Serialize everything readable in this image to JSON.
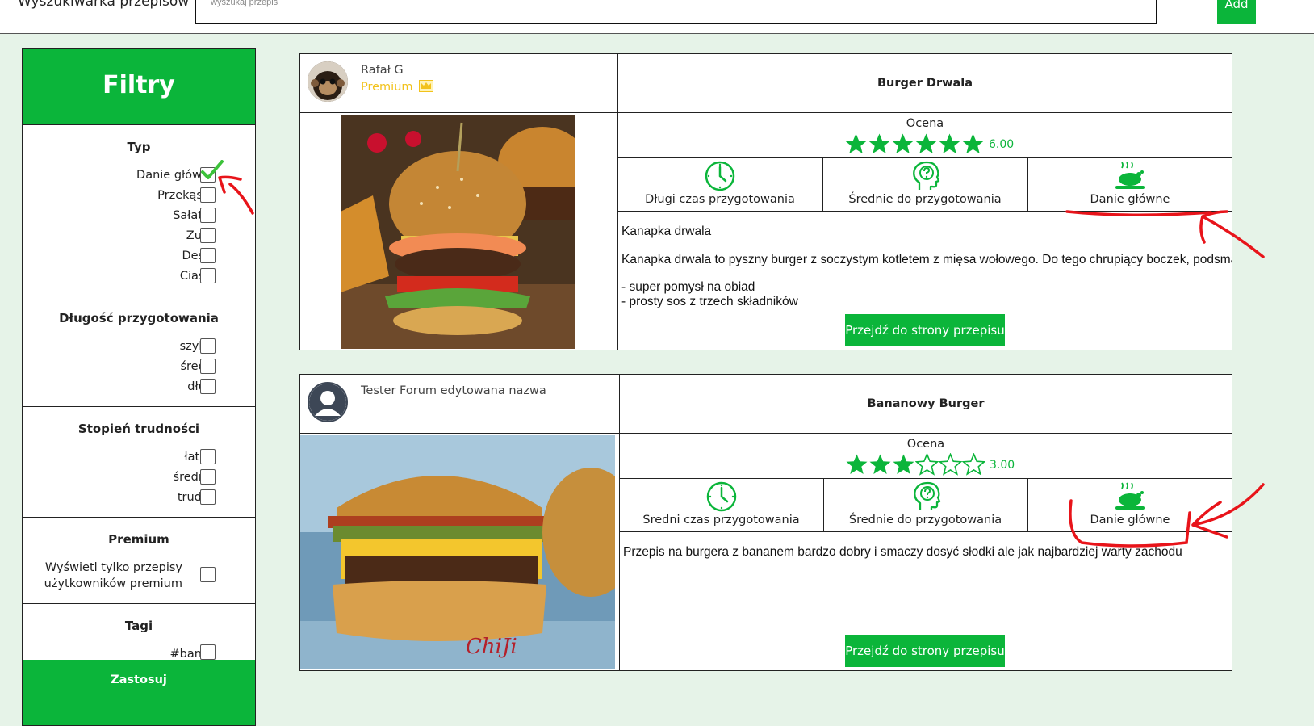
{
  "header": {
    "brand": "Wyszukiwarka przepisów",
    "search_placeholder": "wyszukaj przepis",
    "add_label": "Add"
  },
  "filters": {
    "title": "Filtry",
    "typ": {
      "title": "Typ",
      "options": [
        "Danie główne",
        "Przekąska",
        "Sałatka",
        "Zupa",
        "Deser",
        "Ciasto"
      ],
      "checked": [
        true,
        false,
        false,
        false,
        false,
        false
      ]
    },
    "dlugosc": {
      "title": "Długość przygotowania",
      "options": [
        "szybki",
        "średni",
        "długi"
      ]
    },
    "trudnosc": {
      "title": "Stopień trudności",
      "options": [
        "łatwe",
        "średnie",
        "trudne"
      ]
    },
    "premium": {
      "title": "Premium",
      "option_line1": "Wyświetl tylko przepisy",
      "option_line2": "użytkowników premium"
    },
    "tagi": {
      "title": "Tagi",
      "options": [
        "#banan"
      ]
    },
    "apply_label": "Zastosuj"
  },
  "recipes": [
    {
      "author": "Rafał G",
      "premium_label": "Premium",
      "title": "Burger Drwala",
      "rating_label": "Ocena",
      "rating": 6.0,
      "rating_text": "6.00",
      "stars_filled": 6,
      "stars_total": 6,
      "time_label": "Długi czas przygotowania",
      "difficulty_label": "Średnie do przygotowania",
      "type_label": "Danie główne",
      "desc_title": "Kanapka drwala",
      "desc_text": "Kanapka drwala to pyszny burger z soczystym kotletem z mięsa wołowego. Do tego chrupiący boczek, podsmażana cebulka",
      "desc_bullets": [
        "- super pomysł na obiad",
        "- prosty sos z trzech składników"
      ],
      "button_label": "Przejdź do strony przepisu"
    },
    {
      "author": "Tester Forum edytowana nazwa",
      "title": "Bananowy Burger",
      "rating_label": "Ocena",
      "rating": 3.0,
      "rating_text": "3.00",
      "stars_filled": 3,
      "stars_total": 6,
      "time_label": "Sredni czas przygotowania",
      "difficulty_label": "Średnie do przygotowania",
      "type_label": "Danie główne",
      "desc_text": "Przepis na burgera z bananem bardzo dobry i smaczy dosyć słodki ale jak najbardziej warty zachodu",
      "button_label": "Przejdź do strony przepisu",
      "image_watermark": "ChiJi"
    }
  ],
  "colors": {
    "accent": "#0bb53a",
    "premium": "#f2c21b",
    "annotation": "#e8141a",
    "background": "#e6f3e8"
  }
}
